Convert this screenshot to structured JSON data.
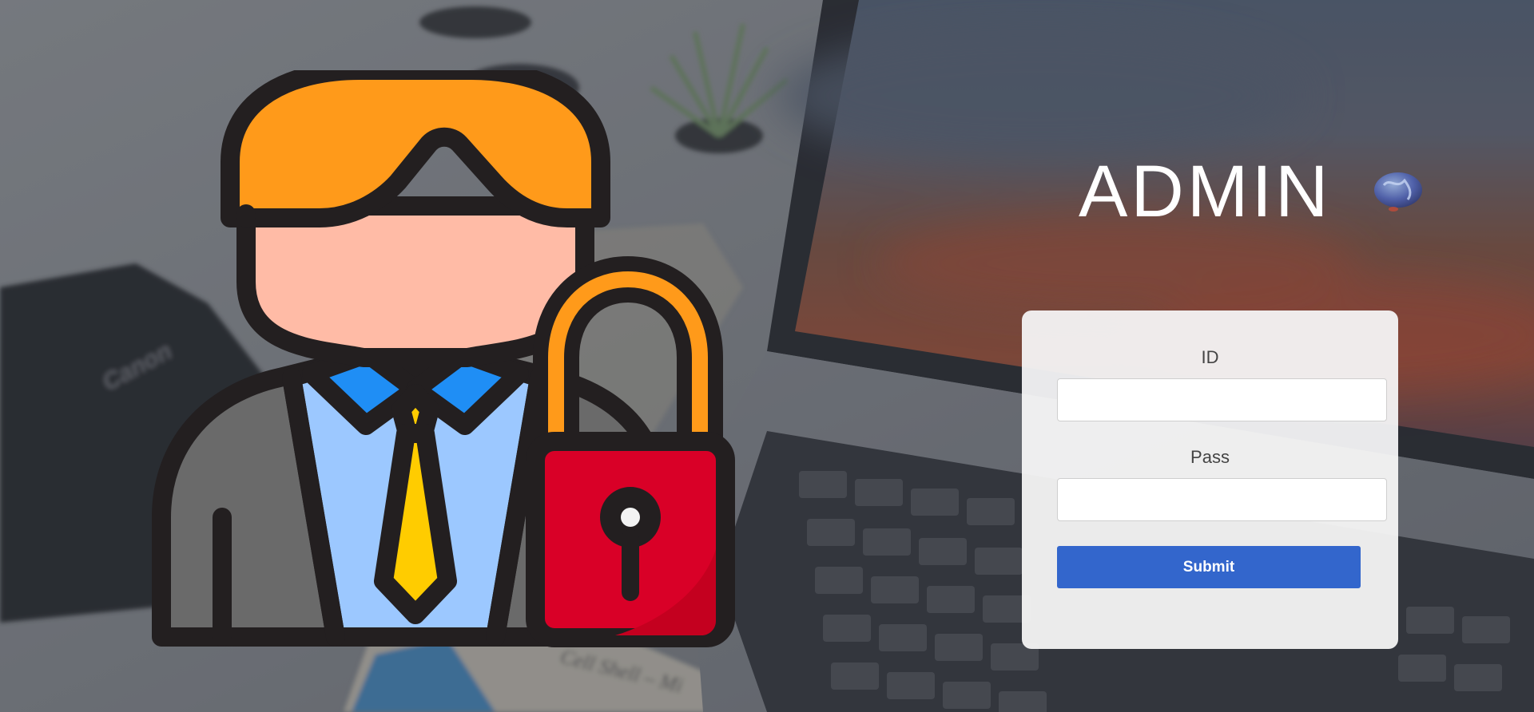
{
  "header": {
    "title": "ADMIN"
  },
  "login_form": {
    "id_label": "ID",
    "id_value": "",
    "pass_label": "Pass",
    "pass_value": "",
    "submit_label": "Submit"
  },
  "background": {
    "camera_brand": "Canon",
    "paper_text": "Cell Shell – Mi"
  },
  "icons": {
    "illustration": "admin-person-with-padlock-icon",
    "decoration": "globe-icon"
  },
  "colors": {
    "accent": "#3366cc",
    "hair": "#ff9a1a",
    "skin": "#ffbba6",
    "tie": "#ffcc00",
    "collar": "#1f8ef5",
    "shirt": "#9cc8ff",
    "suit": "#6a6a6a",
    "lock_body": "#d90027",
    "lock_shackle": "#ff9a1a",
    "outline": "#231f20"
  }
}
